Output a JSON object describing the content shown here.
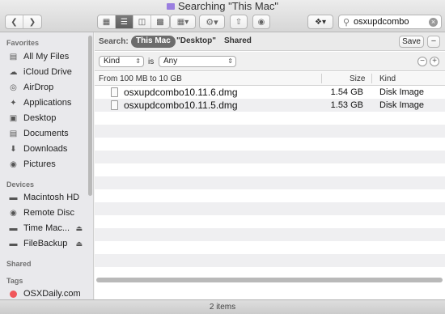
{
  "window": {
    "title": "Searching \"This Mac\""
  },
  "toolbar": {
    "back_icon": "chevron-left-icon",
    "forward_icon": "chevron-right-icon",
    "search": {
      "value": "osxupdcombo"
    }
  },
  "sidebar": {
    "sections": {
      "favorites": "Favorites",
      "devices": "Devices",
      "shared": "Shared",
      "tags": "Tags"
    },
    "favorites": [
      {
        "label": "All My Files",
        "icon": "all-files-icon"
      },
      {
        "label": "iCloud Drive",
        "icon": "cloud-icon"
      },
      {
        "label": "AirDrop",
        "icon": "airdrop-icon"
      },
      {
        "label": "Applications",
        "icon": "applications-icon"
      },
      {
        "label": "Desktop",
        "icon": "desktop-icon"
      },
      {
        "label": "Documents",
        "icon": "documents-icon"
      },
      {
        "label": "Downloads",
        "icon": "downloads-icon"
      },
      {
        "label": "Pictures",
        "icon": "pictures-icon"
      }
    ],
    "devices": [
      {
        "label": "Macintosh HD",
        "icon": "hard-drive-icon"
      },
      {
        "label": "Remote Disc",
        "icon": "disc-icon"
      },
      {
        "label": "Time Mac...",
        "icon": "time-machine-icon",
        "eject": true
      },
      {
        "label": "FileBackup",
        "icon": "drive-icon",
        "eject": true
      }
    ],
    "tags": [
      {
        "label": "OSXDaily.com",
        "color": "#f0565a"
      }
    ]
  },
  "scope": {
    "label": "Search:",
    "this_mac": "This Mac",
    "desktop": "\"Desktop\"",
    "shared": "Shared",
    "save": "Save",
    "minus": "−"
  },
  "criteria": {
    "attribute": "Kind",
    "is": "is",
    "value": "Any",
    "minus": "−",
    "plus": "+"
  },
  "columns": {
    "group": "From 100 MB to 10 GB",
    "size": "Size",
    "kind": "Kind"
  },
  "files": [
    {
      "name": "osxupdcombo10.11.6.dmg",
      "size": "1.54 GB",
      "kind": "Disk Image"
    },
    {
      "name": "osxupdcombo10.11.5.dmg",
      "size": "1.53 GB",
      "kind": "Disk Image"
    }
  ],
  "status": {
    "text": "2 items"
  },
  "colors": {
    "tag_red": "#f0565a",
    "selected_pill": "#6c6c6c",
    "folder_purple": "#9a7ee0"
  }
}
